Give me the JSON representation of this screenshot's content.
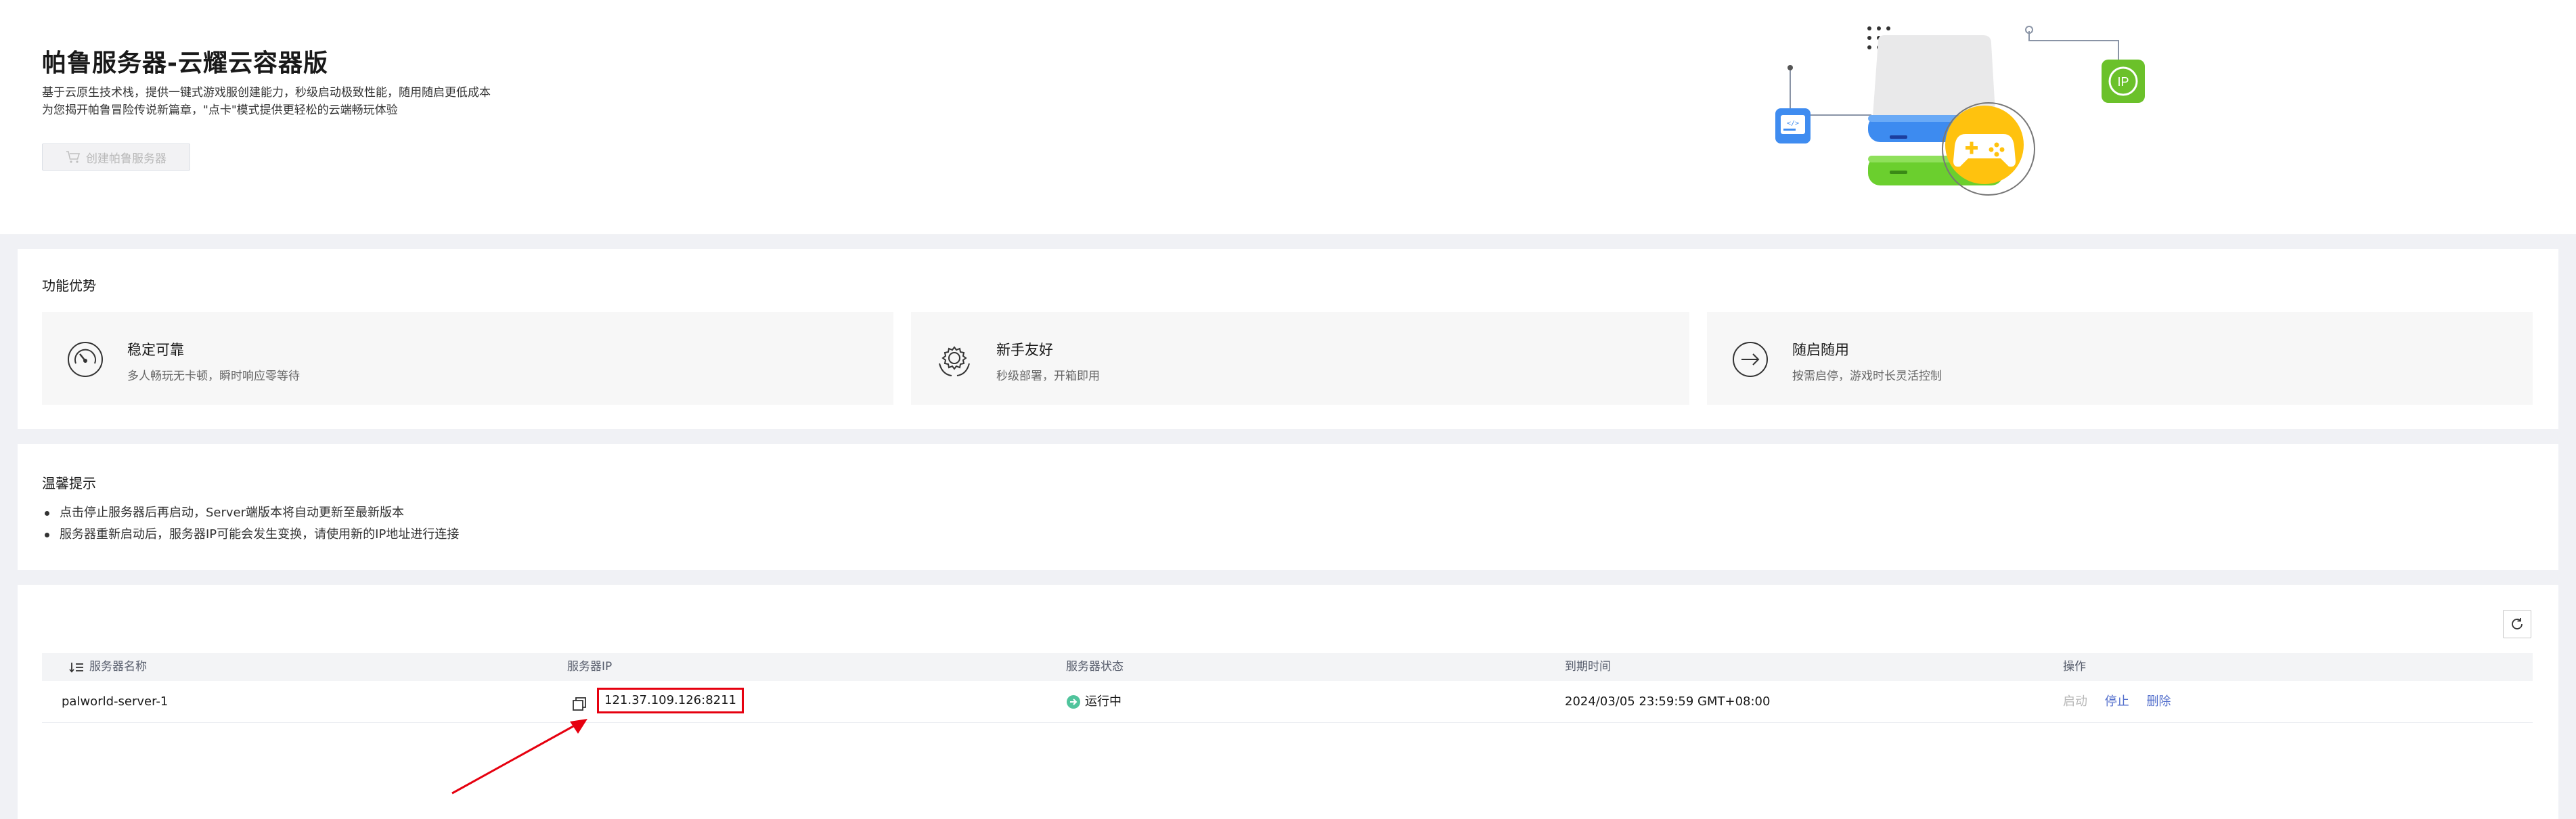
{
  "hero": {
    "title": "帕鲁服务器-云耀云容器版",
    "desc_line1": "基于云原生技术栈，提供一键式游戏服创建能力，秒级启动极致性能，随用随启更低成本",
    "desc_line2": "为您揭开帕鲁冒险传说新篇章，\"点卡\"模式提供更轻松的云端畅玩体验",
    "create_button_label": "创建帕鲁服务器",
    "illustration_ip_badge": "IP"
  },
  "features": {
    "title": "功能优势",
    "items": [
      {
        "title": "稳定可靠",
        "subtitle": "多人畅玩无卡顿，瞬时响应零等待",
        "icon": "gauge-icon"
      },
      {
        "title": "新手友好",
        "subtitle": "秒级部署，开箱即用",
        "icon": "gear-icon"
      },
      {
        "title": "随启随用",
        "subtitle": "按需启停，游戏时长灵活控制",
        "icon": "arrow-circle-icon"
      }
    ]
  },
  "tips": {
    "title": "温馨提示",
    "items": [
      "点击停止服务器后再启动，Server端版本将自动更新至最新版本",
      "服务器重新启动后，服务器IP可能会发生变换，请使用新的IP地址进行连接"
    ]
  },
  "table": {
    "columns": [
      "服务器名称",
      "服务器IP",
      "服务器状态",
      "到期时间",
      "操作"
    ],
    "rows": [
      {
        "name": "palworld-server-1",
        "ip": "121.37.109.126:8211",
        "status": "运行中",
        "expire": "2024/03/05 23:59:59 GMT+08:00",
        "actions": {
          "start": "启动",
          "stop": "停止",
          "delete": "删除"
        }
      }
    ]
  },
  "colors": {
    "accent": "#526ecc",
    "status_running": "#50c49c",
    "highlight": "#e6000f",
    "disabled_text": "#b8b8b8"
  }
}
